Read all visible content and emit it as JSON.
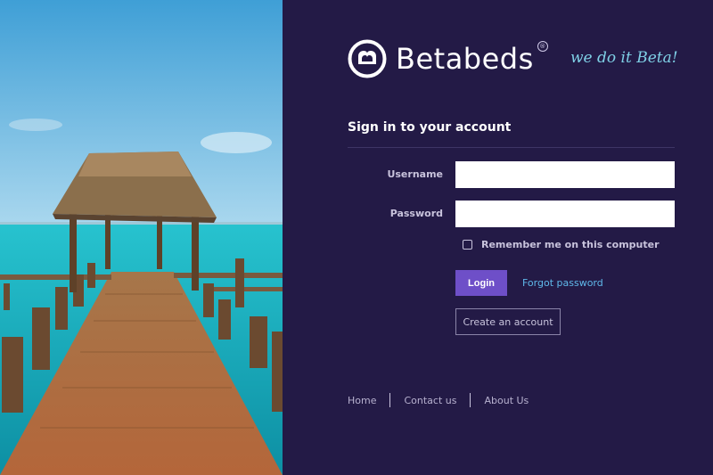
{
  "brand": {
    "name": "Betabeds",
    "registered_mark": "®",
    "tagline": "we do it Beta!"
  },
  "signin": {
    "title": "Sign in to your account",
    "username_label": "Username",
    "username_value": "",
    "password_label": "Password",
    "password_value": "",
    "remember_label": "Remember me on this computer",
    "remember_checked": false,
    "login_label": "Login",
    "forgot_label": "Forgot password",
    "create_label": "Create an account"
  },
  "footer": {
    "links": [
      "Home",
      "Contact us",
      "About Us"
    ]
  },
  "colors": {
    "panel_bg": "#231a46",
    "accent": "#6e4fc8",
    "link": "#5fb8ea",
    "tagline": "#7fd0e6"
  },
  "icons": {
    "logo": "bed-circle-logo"
  }
}
